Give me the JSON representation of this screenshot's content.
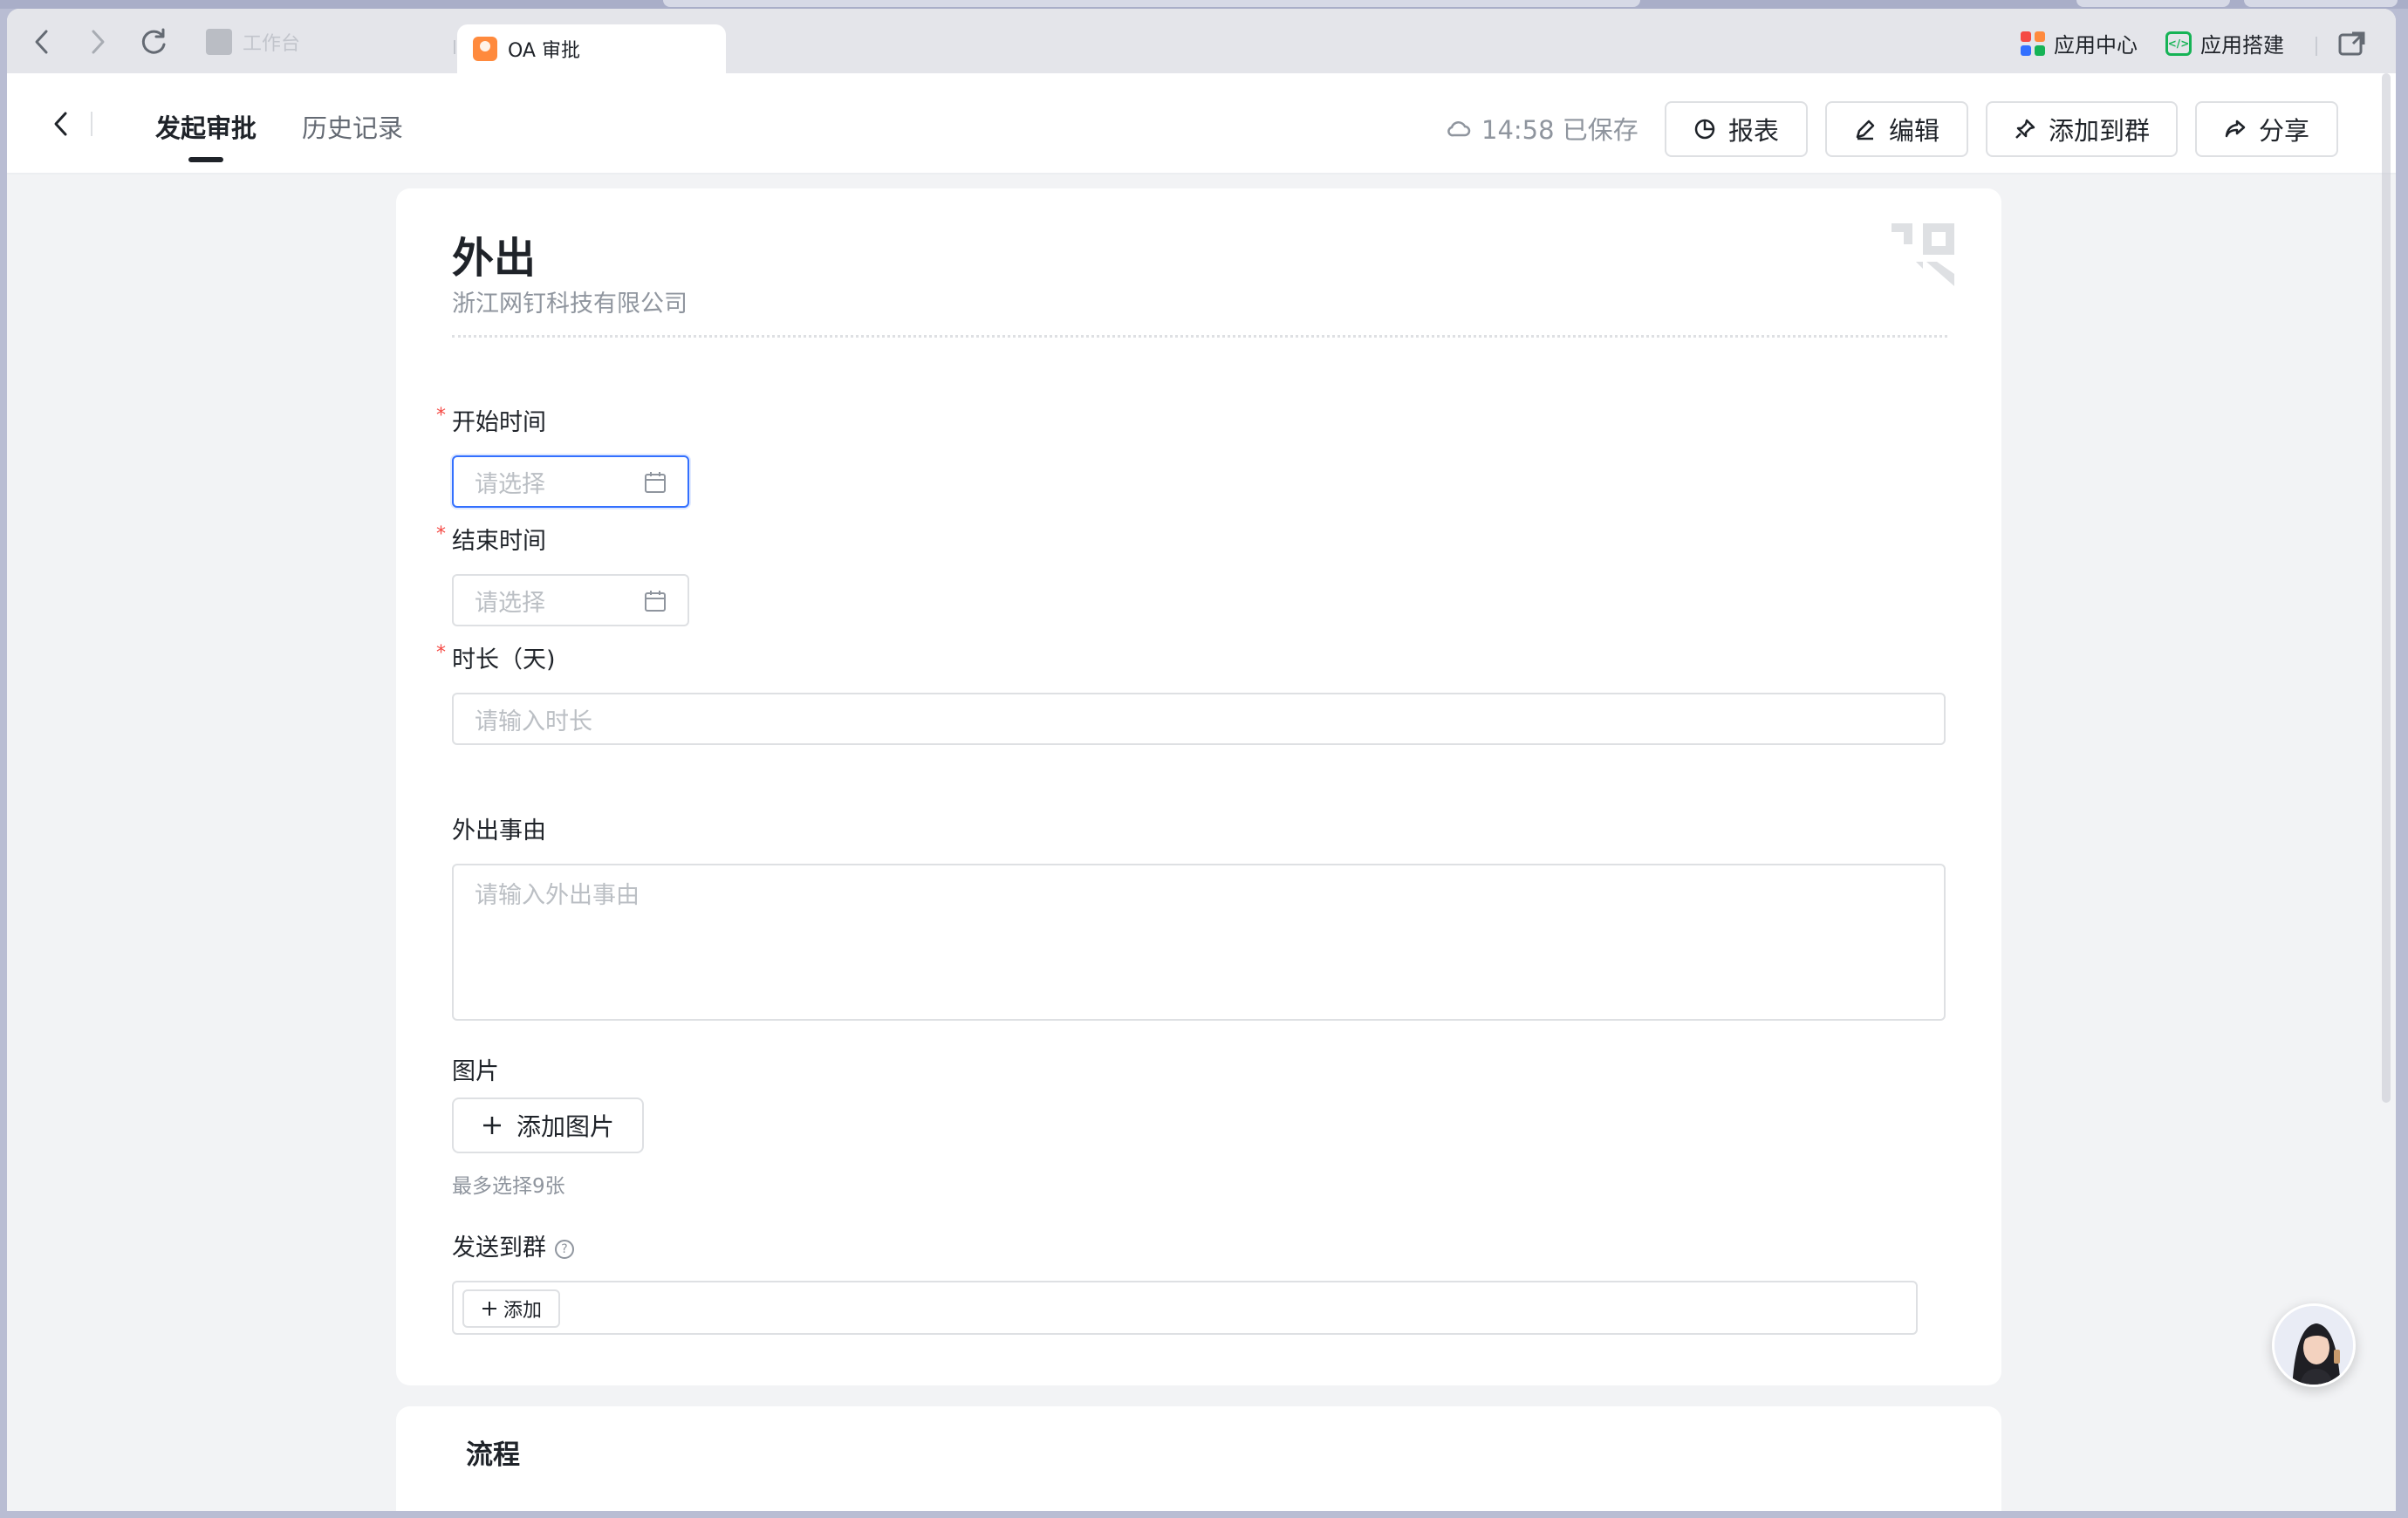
{
  "browser": {
    "tabs": [
      {
        "label": "工作台",
        "active": false
      },
      {
        "label": "OA 审批",
        "active": true
      }
    ],
    "app_center_label": "应用中心",
    "app_build_label": "应用搭建"
  },
  "header": {
    "tabs": [
      {
        "label": "发起审批",
        "active": true
      },
      {
        "label": "历史记录",
        "active": false
      }
    ],
    "saved_status": "14:58 已保存",
    "buttons": {
      "report": "报表",
      "edit": "编辑",
      "add_to_group": "添加到群",
      "share": "分享"
    }
  },
  "form": {
    "title": "外出",
    "company": "浙江网钉科技有限公司",
    "fields": {
      "start_time": {
        "label": "开始时间",
        "required": true,
        "placeholder": "请选择"
      },
      "end_time": {
        "label": "结束时间",
        "required": true,
        "placeholder": "请选择"
      },
      "duration": {
        "label": "时长（天)",
        "required": true,
        "placeholder": "请输入时长"
      },
      "reason": {
        "label": "外出事由",
        "placeholder": "请输入外出事由"
      },
      "images": {
        "label": "图片",
        "button": "添加图片",
        "hint": "最多选择9张"
      },
      "send_to_group": {
        "label": "发送到群",
        "help": "?",
        "button": "添加"
      }
    },
    "required_mark": "*"
  },
  "flow": {
    "title": "流程"
  },
  "colors": {
    "accent": "#3370ff",
    "required": "#f54a45",
    "muted_text": "#8f959e",
    "placeholder": "#bbbfc4",
    "build_icon": "#16b356"
  }
}
